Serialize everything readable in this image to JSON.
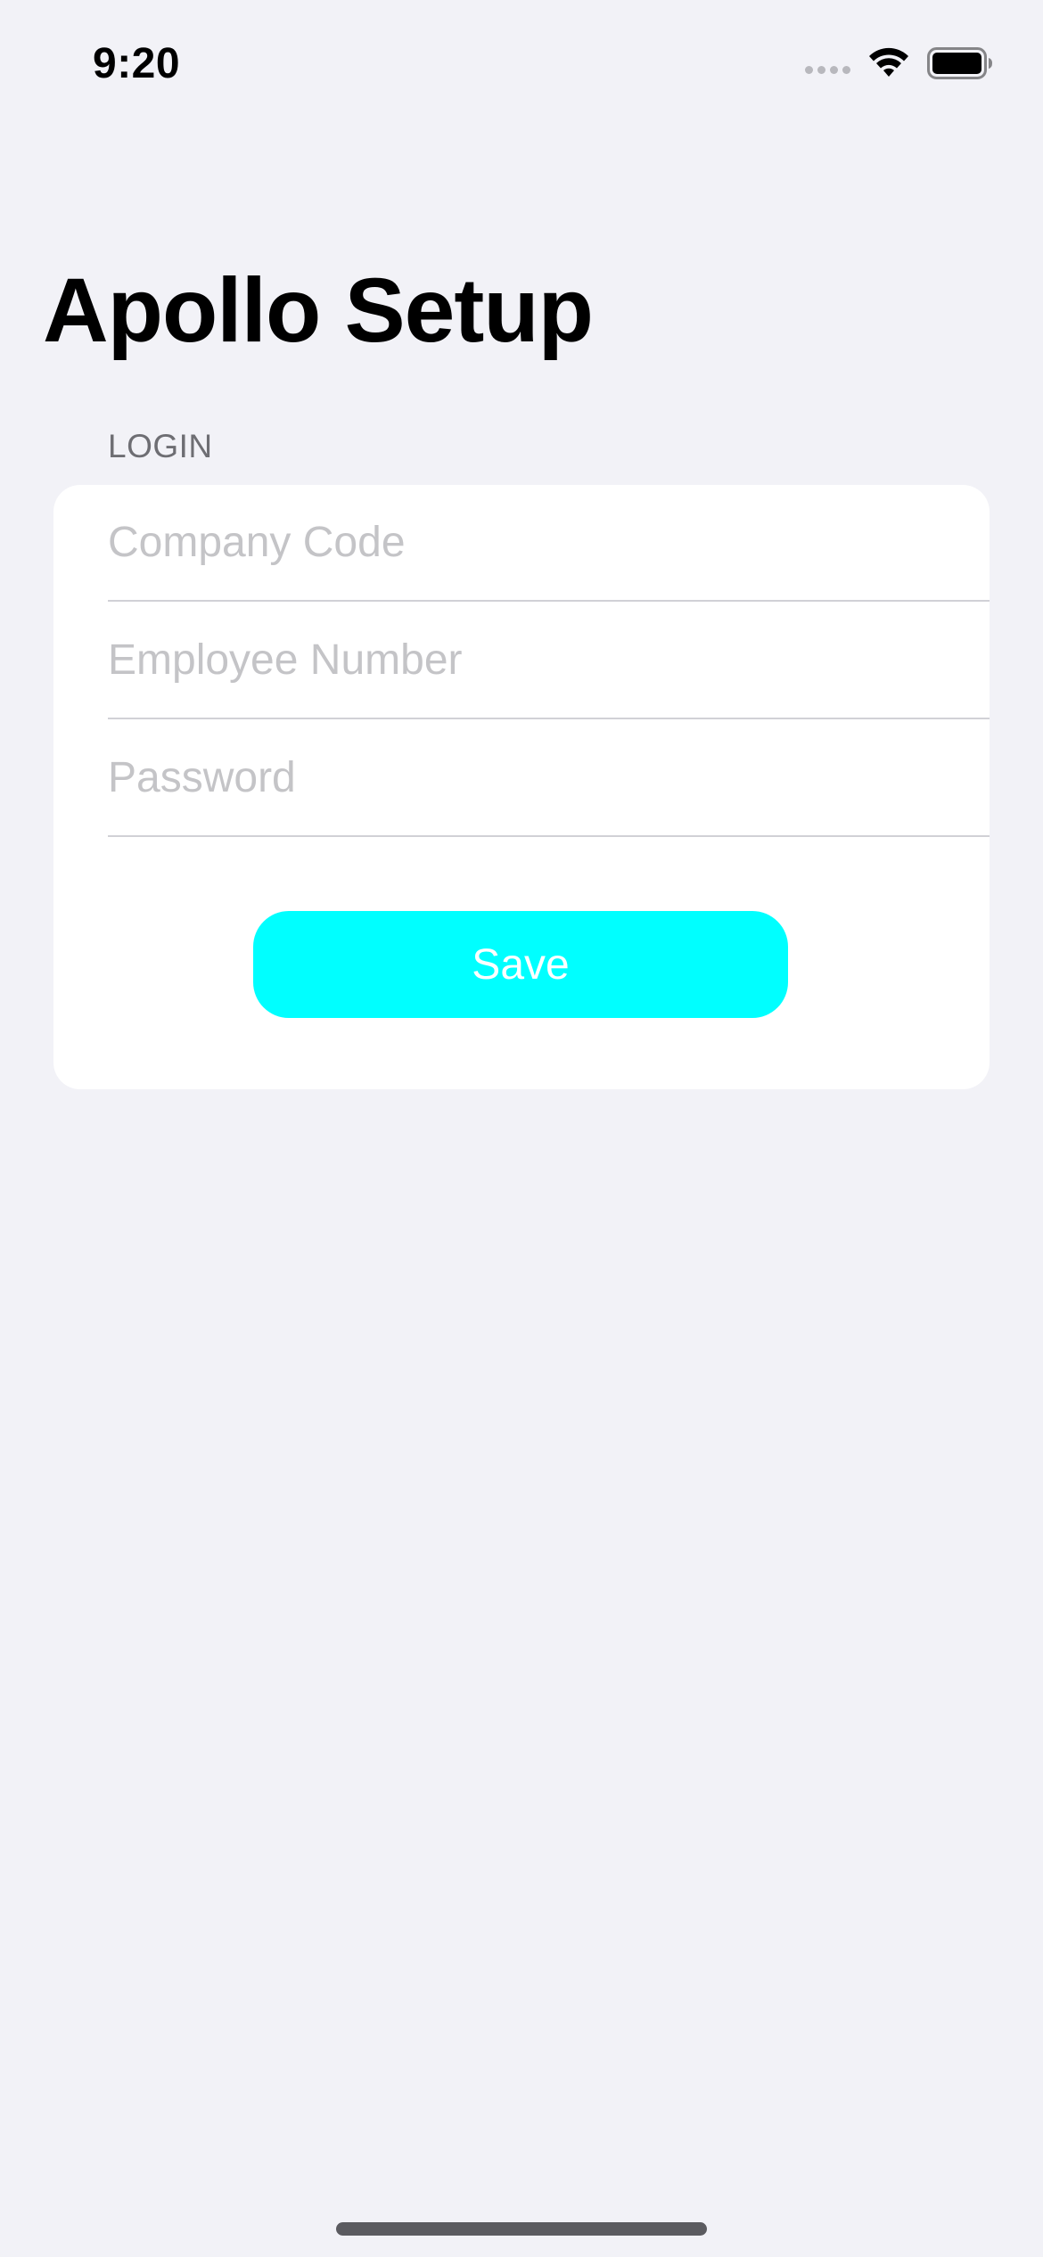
{
  "status_bar": {
    "time": "9:20",
    "icons": [
      "cellular-signal-icon",
      "wifi-icon",
      "battery-icon"
    ]
  },
  "header": {
    "title": "Apollo Setup"
  },
  "login_section": {
    "header": "LOGIN",
    "fields": [
      {
        "placeholder": "Company Code",
        "value": ""
      },
      {
        "placeholder": "Employee Number",
        "value": ""
      },
      {
        "placeholder": "Password",
        "value": ""
      }
    ],
    "save_label": "Save"
  },
  "colors": {
    "background": "#f2f2f7",
    "card": "#ffffff",
    "accent": "#00ffff",
    "placeholder": "#c4c4c7",
    "section_header": "#6e6e73"
  }
}
